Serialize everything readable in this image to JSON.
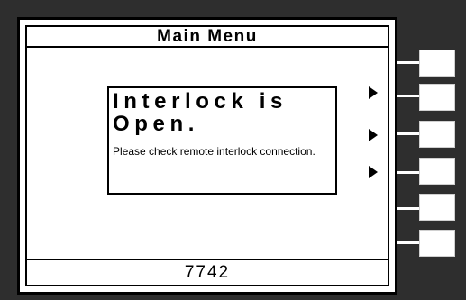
{
  "screen": {
    "title": "Main Menu",
    "footer_value": "7742"
  },
  "dialog": {
    "title": "Interlock is\nOpen.",
    "message": "Please check remote interlock connection."
  },
  "arrows": [
    {
      "name": "softkey-arrow-2",
      "icon": "triangle-right-icon"
    },
    {
      "name": "softkey-arrow-3",
      "icon": "triangle-right-icon"
    },
    {
      "name": "softkey-arrow-4",
      "icon": "triangle-right-icon"
    }
  ],
  "softkeys": [
    {
      "name": "softkey-1"
    },
    {
      "name": "softkey-2"
    },
    {
      "name": "softkey-3"
    },
    {
      "name": "softkey-4"
    },
    {
      "name": "softkey-5"
    },
    {
      "name": "softkey-6"
    }
  ],
  "colors": {
    "bezel": "#2e2e2e",
    "screen": "#ffffff",
    "ink": "#000000"
  }
}
